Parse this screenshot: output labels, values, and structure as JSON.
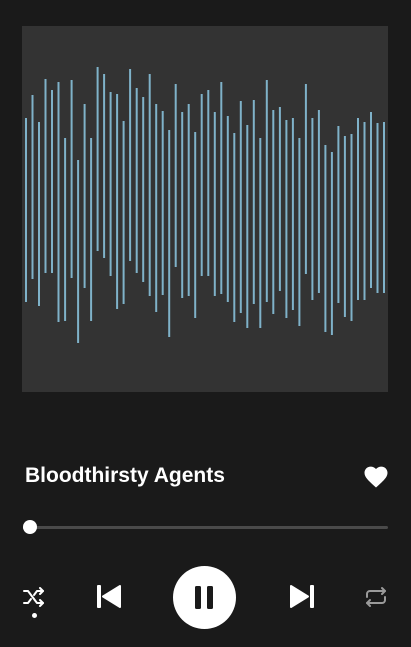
{
  "player": {
    "track_title": "Bloodthirsty Agents",
    "liked": true,
    "progress": 0.02,
    "is_playing": true,
    "shuffle_enabled": true
  },
  "artwork": {
    "background_color": "#333333",
    "bar_color": "#7fb2c9"
  },
  "icons": {
    "like": "heart-icon",
    "shuffle": "shuffle-icon",
    "previous": "skip-previous-icon",
    "pause": "pause-icon",
    "next": "skip-next-icon",
    "repeat": "repeat-icon"
  }
}
